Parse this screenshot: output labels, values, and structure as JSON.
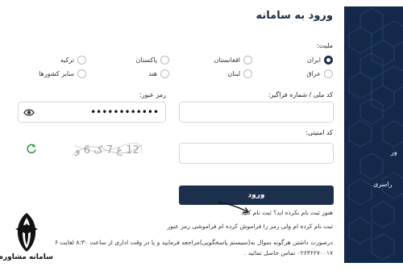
{
  "page": {
    "title": "ورود به سامانه"
  },
  "nationality": {
    "label": "ملیت:",
    "options": [
      {
        "label": "ایران",
        "selected": true
      },
      {
        "label": "افغانستان",
        "selected": false
      },
      {
        "label": "پاکستان",
        "selected": false
      },
      {
        "label": "ترکیه",
        "selected": false
      },
      {
        "label": "عراق",
        "selected": false
      },
      {
        "label": "لبنان",
        "selected": false
      },
      {
        "label": "هند",
        "selected": false
      },
      {
        "label": "سایر کشورها",
        "selected": false
      }
    ]
  },
  "national_code": {
    "label": "کد ملی / شماره فراگیر:",
    "value": ""
  },
  "password": {
    "label": "رمز عبور:",
    "value": "••••••••••••"
  },
  "security_code": {
    "label": "کد امنیتی:",
    "value": ""
  },
  "captcha": {
    "text": "12 ع 7 ک 6 و"
  },
  "submit": {
    "label": "ورود"
  },
  "links": {
    "signup_question": "هنوز ثبت نام نکرده اید؟",
    "signup_link": "ثبت نام کنید",
    "forgot_prefix": "ثبت نام کرده ام ولی رمز را فراموش کرده ام",
    "forgot_link": "فراموشی رمز عبور"
  },
  "notice": {
    "line1": "درصورت داشتن هرگونه سوال به(سیستم پاسخگویی)مراجعه فرمایید و یا در وقت اداری از ساعت ۸:۳۰ لغایت ۱۶",
    "line2": "۰۲۶۳۶۲۷۰۰۱۷ تماس حاصل نمائید ."
  },
  "side": {
    "text1": "ور",
    "text2": "راسری"
  },
  "watermark": {
    "text": "سامانه مشاوره هپوا"
  },
  "colors": {
    "primary": "#1c2f4d",
    "side": "#13294a"
  }
}
